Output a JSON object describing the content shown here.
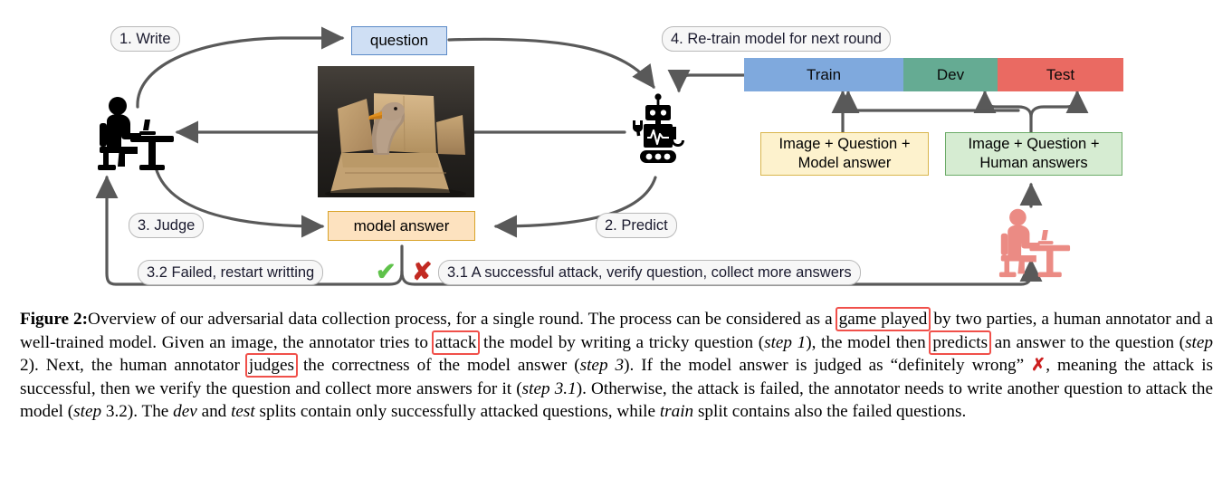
{
  "figure": {
    "label": "Figure 2:",
    "caption_parts": {
      "p1": "Overview of our adversarial data collection process, for a single round. The process can be considered as a ",
      "hl1": "game played",
      "p2": " by two parties, a human annotator and a well-trained model. Given an image, the annotator tries to ",
      "hl2": "attack",
      "p3": " the model by writing a tricky question (",
      "i1": "step 1",
      "p4": "), the model then ",
      "hl3": "predicts",
      "p5": " an answer to the question (",
      "i2": "step",
      "p6": " 2). Next, the human annotator ",
      "hl4": "judges",
      "p7": " the correctness of the model answer (",
      "i3": "step 3",
      "p8": "). If the model answer is judged as “definitely wrong” ",
      "xmark": "✗",
      "p9": ", meaning the attack is successful, then we verify the question and collect more answers for it (",
      "i4": "step 3.1",
      "p10": "). Otherwise, the attack is failed, the annotator needs to write another question to attack the model (",
      "i5": "step",
      "p11": " 3.2). The ",
      "i6": "dev",
      "p12": " and ",
      "i7": "test",
      "p13": " splits contain only successfully attacked questions, while ",
      "i8": "train",
      "p14": " split contains also the failed questions."
    }
  },
  "diagram": {
    "steps": {
      "write": "1. Write",
      "predict": "2. Predict",
      "judge": "3. Judge",
      "failed": "3.2 Failed, restart writting",
      "success": "3.1 A successful attack, verify question, collect more answers",
      "retrain": "4. Re-train model for next round"
    },
    "nodes": {
      "question": "question",
      "model_answer": "model answer",
      "yellow_box_line1": "Image + Question +",
      "yellow_box_line2": "Model answer",
      "green_box_line1": "Image + Question +",
      "green_box_line2": "Human answers"
    },
    "splits": [
      {
        "label": "Train",
        "color": "#7fa9dd"
      },
      {
        "label": "Dev",
        "color": "#65ab93"
      },
      {
        "label": "Test",
        "color": "#ea6a62"
      }
    ],
    "marks": {
      "check": "✔",
      "cross": "✘"
    },
    "icons": {
      "annotator_black": "person-at-desk-icon",
      "annotator_pink": "person-at-desk-icon",
      "model": "robot-icon",
      "photo": "duck-in-cardboard-box-photo"
    },
    "colors": {
      "arrow": "#595959",
      "accent_check": "#5fc24a",
      "accent_cross": "#c22a22",
      "pink": "#eb8b84",
      "highlight": "#f0504a"
    }
  }
}
